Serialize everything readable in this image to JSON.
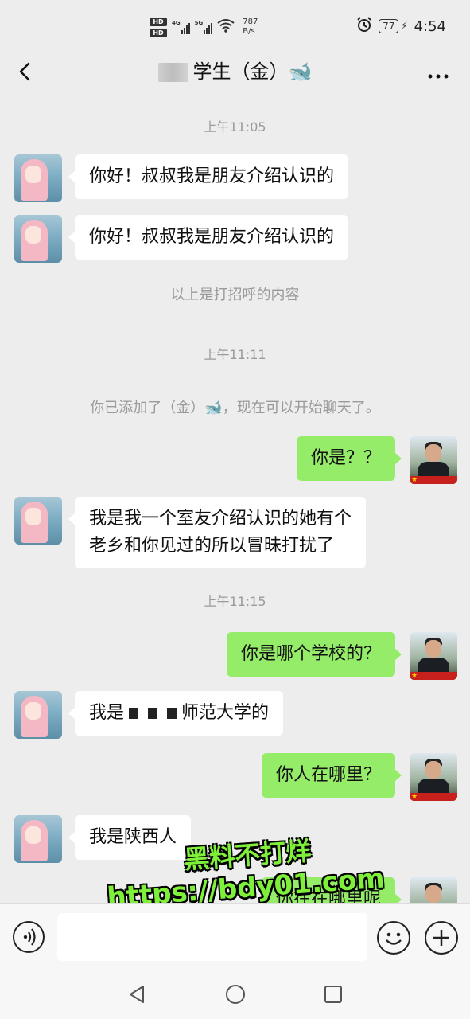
{
  "status_bar": {
    "hd_badges": [
      "HD",
      "HD"
    ],
    "signal_labels": [
      "4G",
      "5G"
    ],
    "net_speed": "787",
    "net_speed_unit": "B/s",
    "battery": "77",
    "time": "4:54"
  },
  "header": {
    "title": "学生（金）",
    "title_emoji": "🐋",
    "back_icon": "chevron-left-icon",
    "more_icon": "more-dots-icon"
  },
  "timestamps": [
    "上午11:05",
    "上午11:11",
    "上午11:15"
  ],
  "system_notes": {
    "greeting_note": "以上是打招呼的内容",
    "added_note": "你已添加了（金）🐋，现在可以开始聊天了。"
  },
  "messages": [
    {
      "side": "in",
      "text": "你好！叔叔我是朋友介绍认识的"
    },
    {
      "side": "in",
      "text": "你好！叔叔我是朋友介绍认识的"
    },
    {
      "side": "out",
      "text": "你是？？"
    },
    {
      "side": "in",
      "text_line1": "我是我一个室友介绍认识的她有个",
      "text_line2": "老乡和你见过的所以冒昧打扰了"
    },
    {
      "side": "out",
      "text": "你是哪个学校的？"
    },
    {
      "side": "in",
      "prefix": "我是",
      "suffix": "师范大学的"
    },
    {
      "side": "out",
      "text": "你人在哪里？"
    },
    {
      "side": "in",
      "text": "我是陕西人"
    },
    {
      "side": "out",
      "text": "你在在哪里呢"
    }
  ],
  "watermark": {
    "line1": "黑料不打烊",
    "line2": "https://bdy01.com"
  },
  "input_bar": {
    "placeholder": "",
    "icons": [
      "voice-icon",
      "emoji-icon",
      "plus-icon"
    ]
  },
  "nav_bar": {
    "icons": [
      "nav-back-icon",
      "nav-home-icon",
      "nav-recents-icon"
    ]
  }
}
